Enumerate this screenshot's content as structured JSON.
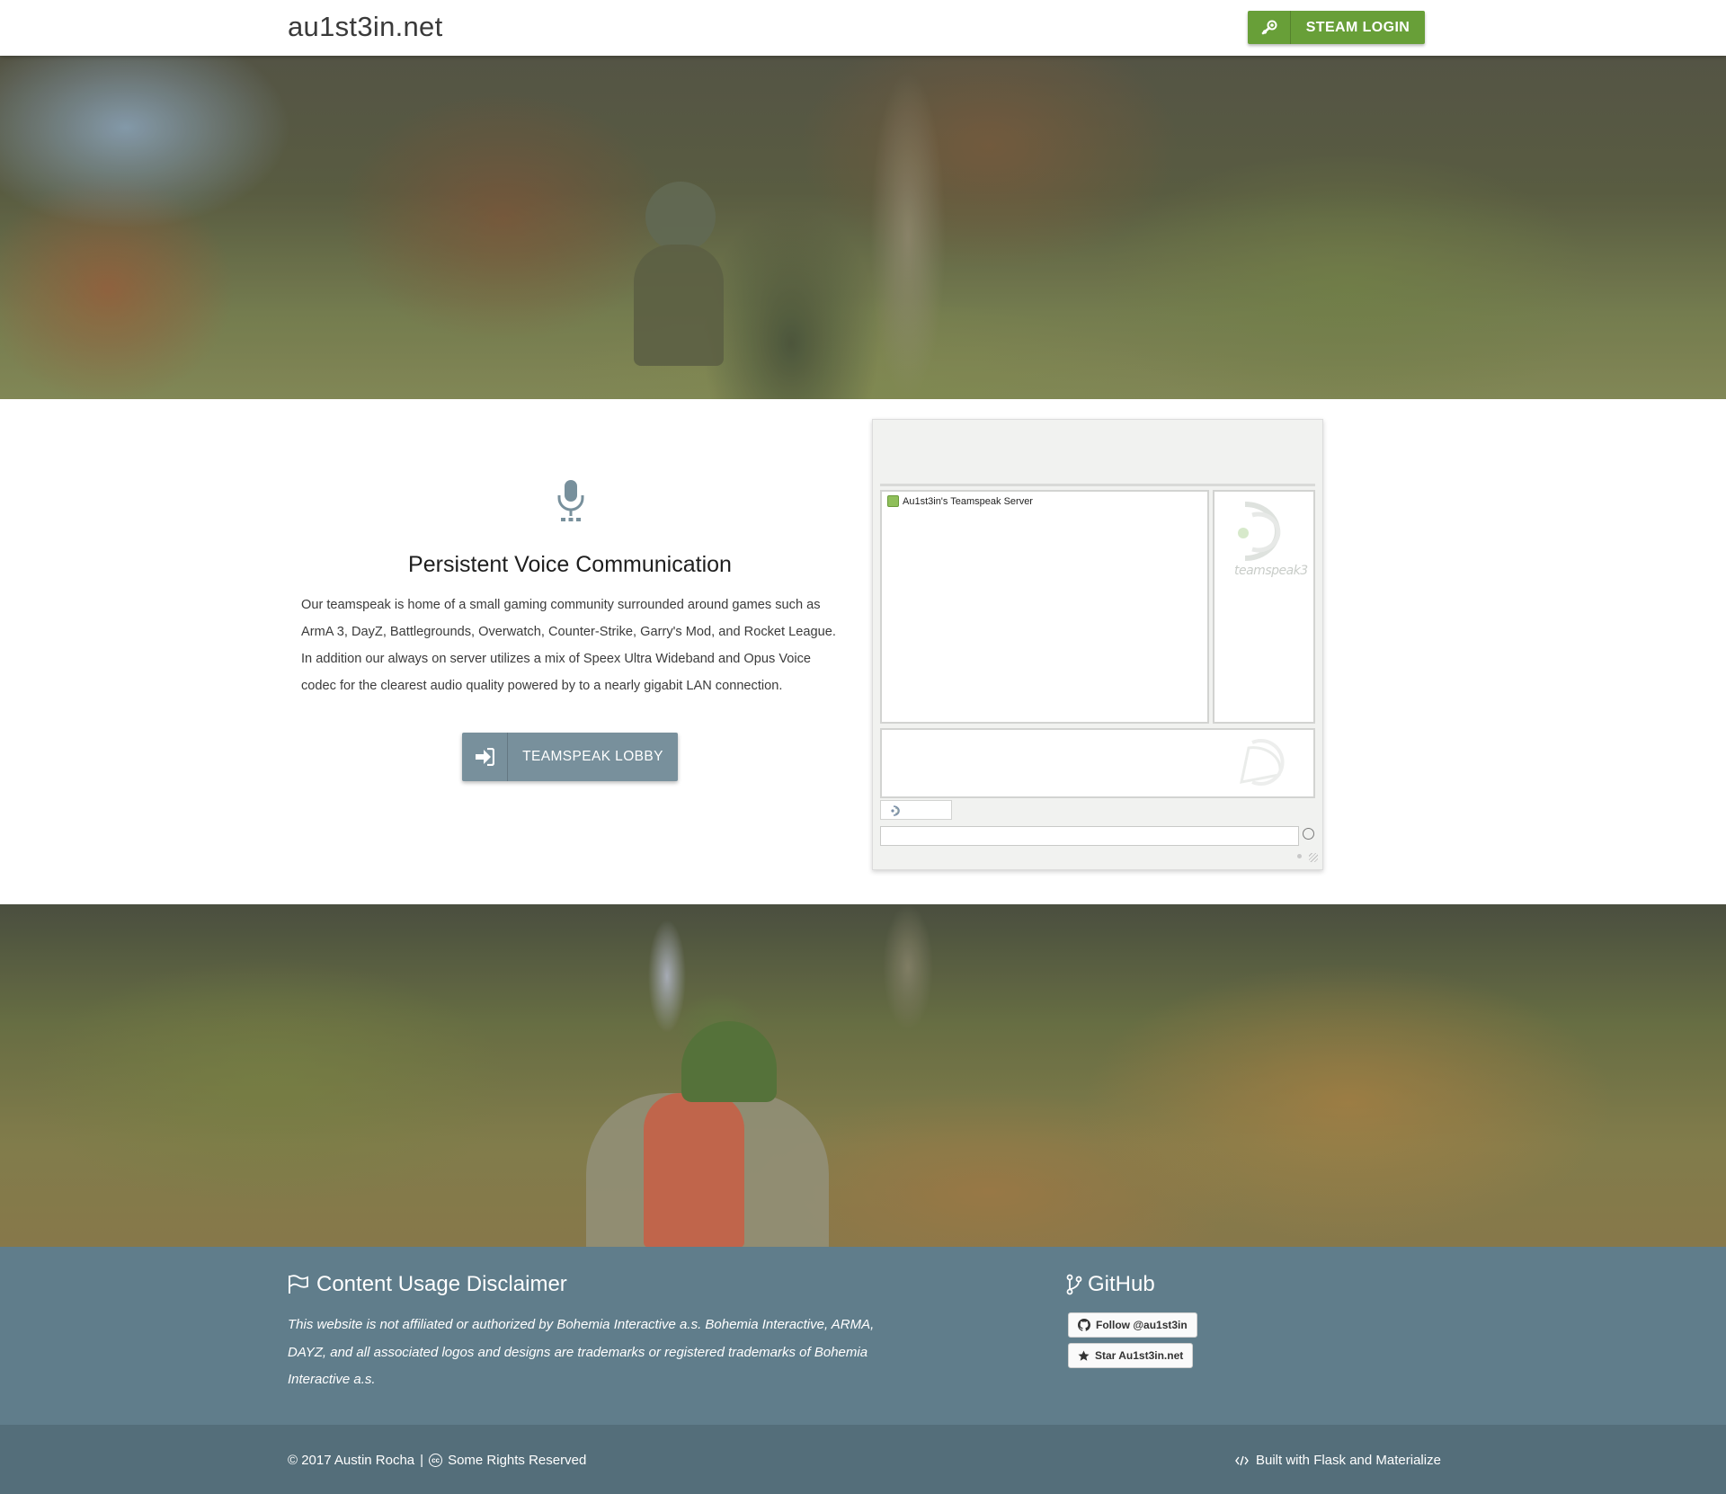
{
  "header": {
    "brand": "au1st3in.net",
    "steam_login": "STEAM LOGIN",
    "steam_icon": "steam-icon"
  },
  "voice": {
    "icon": "microphone-icon",
    "title": "Persistent Voice Communication",
    "description": "Our teamspeak is home of a small gaming community surrounded around games such as ArmA 3, DayZ, Battlegrounds, Overwatch, Counter-Strike, Garry's Mod, and Rocket League. In addition our always on server utilizes a mix of Speex Ultra Wideband and Opus Voice codec for the clearest audio quality powered by to a nearly gigabit LAN connection.",
    "lobby_button": "TEAMSPEAK LOBBY",
    "lobby_icon": "sign-in-icon"
  },
  "teamspeak_widget": {
    "server_name": "Au1st3in's Teamspeak Server",
    "logo_text": "teamspeak3"
  },
  "footer": {
    "disclaimer_title": "Content Usage Disclaimer",
    "disclaimer_icon": "flag-icon",
    "disclaimer_text": "This website is not affiliated or authorized by Bohemia Interactive a.s. Bohemia Interactive, ARMA, DAYZ, and all associated logos and designs are trademarks or registered trademarks of Bohemia Interactive a.s.",
    "github_title": "GitHub",
    "github_icon": "git-branch-icon",
    "follow_button": "Follow @au1st3in",
    "star_button": "Star Au1st3in.net",
    "copyright": "© 2017 Austin Rocha",
    "separator": "|",
    "rights": "Some Rights Reserved",
    "built_with": "Built with Flask and Materialize"
  },
  "colors": {
    "steam_green": "#689f38",
    "lobby_gray": "#78909c",
    "footer": "#607d8b",
    "footer_bottom": "#546e7a"
  }
}
